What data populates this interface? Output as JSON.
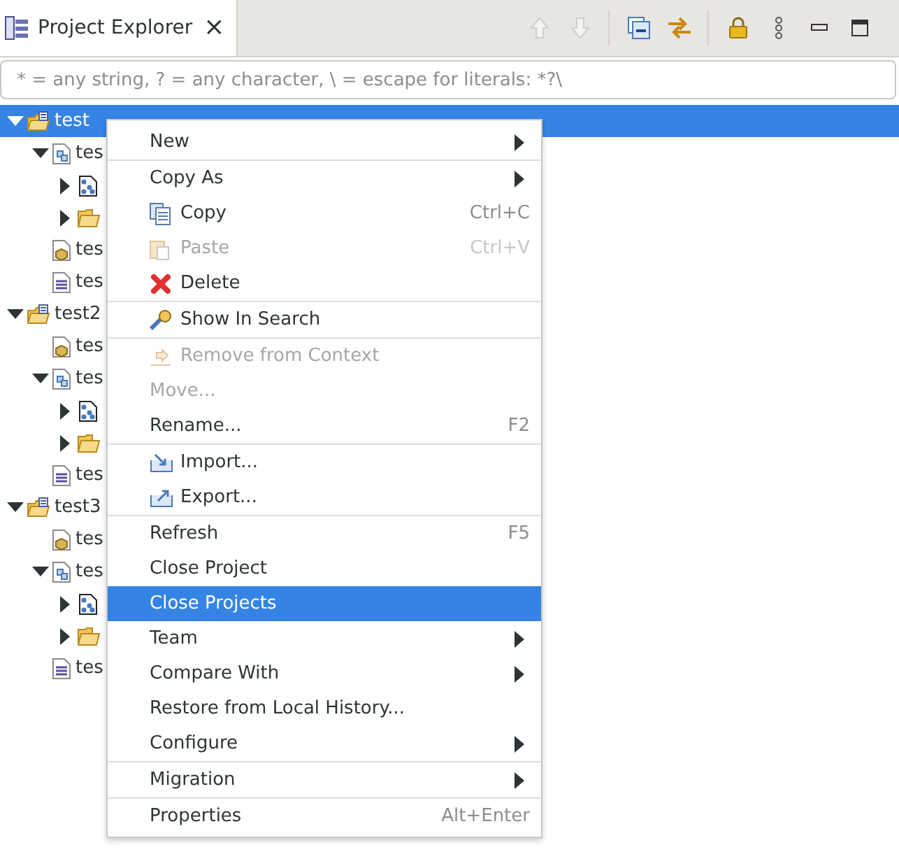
{
  "view_tab": {
    "title": "Project Explorer",
    "close": "×",
    "selected": true
  },
  "toolbar": [
    {
      "kind": "up",
      "disabled": true
    },
    {
      "kind": "down",
      "disabled": true
    },
    {
      "kind": "sep"
    },
    {
      "kind": "collapse"
    },
    {
      "kind": "link"
    },
    {
      "kind": "sep"
    },
    {
      "kind": "lock"
    },
    {
      "kind": "more"
    },
    {
      "kind": "minimize"
    },
    {
      "kind": "maximize"
    }
  ],
  "filter": {
    "placeholder": "* = any string, ? = any character, \\ = escape for literals: *?\\"
  },
  "tree": [
    {
      "label": "test",
      "kind": "project",
      "expanded": true,
      "selected": true,
      "children": [
        {
          "label": "tes",
          "kind": "module",
          "expanded": true,
          "selected": false,
          "children": [
            {
              "kind": "diagram",
              "expanded": false,
              "selected": false
            },
            {
              "kind": "folder",
              "expanded": false,
              "selected": false
            }
          ]
        },
        {
          "label": "tes",
          "kind": "config",
          "selected": false
        },
        {
          "label": "tes",
          "kind": "text",
          "selected": false
        }
      ]
    },
    {
      "label": "test2",
      "kind": "project",
      "expanded": true,
      "selected": false,
      "children": [
        {
          "label": "tes",
          "kind": "config",
          "selected": false
        },
        {
          "label": "tes",
          "kind": "module",
          "expanded": true,
          "selected": false,
          "children": [
            {
              "kind": "diagram",
              "expanded": false,
              "selected": false
            },
            {
              "kind": "folder",
              "expanded": false,
              "selected": false
            }
          ]
        },
        {
          "label": "tes",
          "kind": "text",
          "selected": false
        }
      ]
    },
    {
      "label": "test3",
      "kind": "project",
      "expanded": true,
      "selected": false,
      "children": [
        {
          "label": "tes",
          "kind": "config",
          "selected": false
        },
        {
          "label": "tes",
          "kind": "module",
          "expanded": true,
          "selected": false,
          "children": [
            {
              "kind": "diagram",
              "expanded": false,
              "selected": false
            },
            {
              "kind": "folder",
              "expanded": false,
              "selected": false
            }
          ]
        },
        {
          "label": "tes",
          "kind": "text",
          "selected": false
        }
      ]
    }
  ],
  "context_menu": [
    {
      "kind": "plain",
      "label": "New",
      "submenu": true,
      "disabled": false,
      "selected": false
    },
    {
      "kind": "separator"
    },
    {
      "kind": "plain",
      "label": "Copy As",
      "submenu": true,
      "disabled": false,
      "selected": false
    },
    {
      "kind": "copy",
      "label": "Copy",
      "shortcut": "Ctrl+C",
      "submenu": false,
      "disabled": false,
      "selected": false
    },
    {
      "kind": "paste",
      "label": "Paste",
      "shortcut": "Ctrl+V",
      "submenu": false,
      "disabled": true,
      "selected": false
    },
    {
      "kind": "delete",
      "label": "Delete",
      "submenu": false,
      "disabled": false,
      "selected": false
    },
    {
      "kind": "separator"
    },
    {
      "kind": "search",
      "label": "Show In Search",
      "submenu": false,
      "disabled": false,
      "selected": false
    },
    {
      "kind": "separator"
    },
    {
      "kind": "remove",
      "label": "Remove from Context",
      "submenu": false,
      "disabled": true,
      "selected": false
    },
    {
      "kind": "plain",
      "label": "Move...",
      "submenu": false,
      "disabled": true,
      "selected": false
    },
    {
      "kind": "plain",
      "label": "Rename...",
      "shortcut": "F2",
      "submenu": false,
      "disabled": false,
      "selected": false
    },
    {
      "kind": "separator"
    },
    {
      "kind": "import",
      "label": "Import...",
      "submenu": false,
      "disabled": false,
      "selected": false
    },
    {
      "kind": "export",
      "label": "Export...",
      "submenu": false,
      "disabled": false,
      "selected": false
    },
    {
      "kind": "separator"
    },
    {
      "kind": "plain",
      "label": "Refresh",
      "shortcut": "F5",
      "submenu": false,
      "disabled": false,
      "selected": false
    },
    {
      "kind": "plain",
      "label": "Close Project",
      "submenu": false,
      "disabled": false,
      "selected": false
    },
    {
      "kind": "plain",
      "label": "Close Projects",
      "submenu": false,
      "disabled": false,
      "selected": true
    },
    {
      "kind": "plain",
      "label": "Team",
      "submenu": true,
      "disabled": false,
      "selected": false
    },
    {
      "kind": "plain",
      "label": "Compare With",
      "submenu": true,
      "disabled": false,
      "selected": false
    },
    {
      "kind": "plain",
      "label": "Restore from Local History...",
      "submenu": false,
      "disabled": false,
      "selected": false
    },
    {
      "kind": "plain",
      "label": "Configure",
      "submenu": true,
      "disabled": false,
      "selected": false
    },
    {
      "kind": "separator"
    },
    {
      "kind": "plain",
      "label": "Migration",
      "submenu": true,
      "disabled": false,
      "selected": false
    },
    {
      "kind": "separator"
    },
    {
      "kind": "plain",
      "label": "Properties",
      "shortcut": "Alt+Enter",
      "submenu": false,
      "disabled": false,
      "selected": false
    }
  ]
}
